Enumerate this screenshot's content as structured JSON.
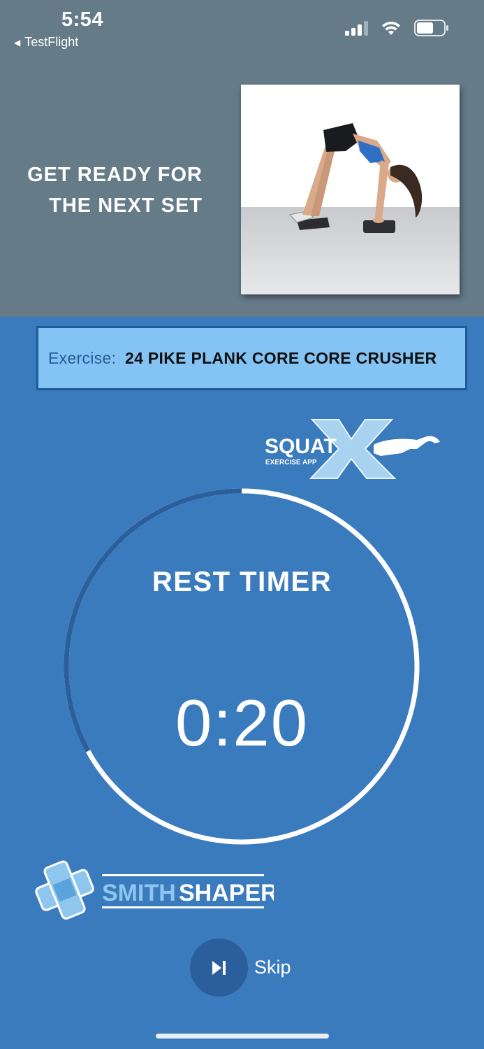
{
  "status_bar": {
    "time": "5:54",
    "back_label": "TestFlight",
    "signal_icon": "cellular-signal-icon",
    "wifi_icon": "wifi-icon",
    "battery_icon": "battery-icon"
  },
  "header": {
    "line1": "GET READY FOR",
    "line2": "THE NEXT SET",
    "image_alt": "Woman performing a pike plank on two pads"
  },
  "exercise": {
    "label": "Exercise:",
    "name": "24 PIKE PLANK CORE CORE CRUSHER"
  },
  "brand_top": {
    "word": "SQUAT",
    "letter": "X",
    "subtitle": "EXERCISE APP"
  },
  "timer": {
    "title": "REST TIMER",
    "value": "0:20",
    "elapsed_fraction": 0.33
  },
  "brand_bottom": {
    "part1": "SMITH",
    "part2": "SHAPER"
  },
  "controls": {
    "skip_label": "Skip",
    "skip_icon": "skip-next-icon"
  },
  "colors": {
    "top_bg": "#657b88",
    "main_bg": "#3a7bbd",
    "exercise_box_bg": "#84c4f5",
    "ring_remaining": "#ffffff",
    "ring_elapsed": "#2b5f9c"
  }
}
